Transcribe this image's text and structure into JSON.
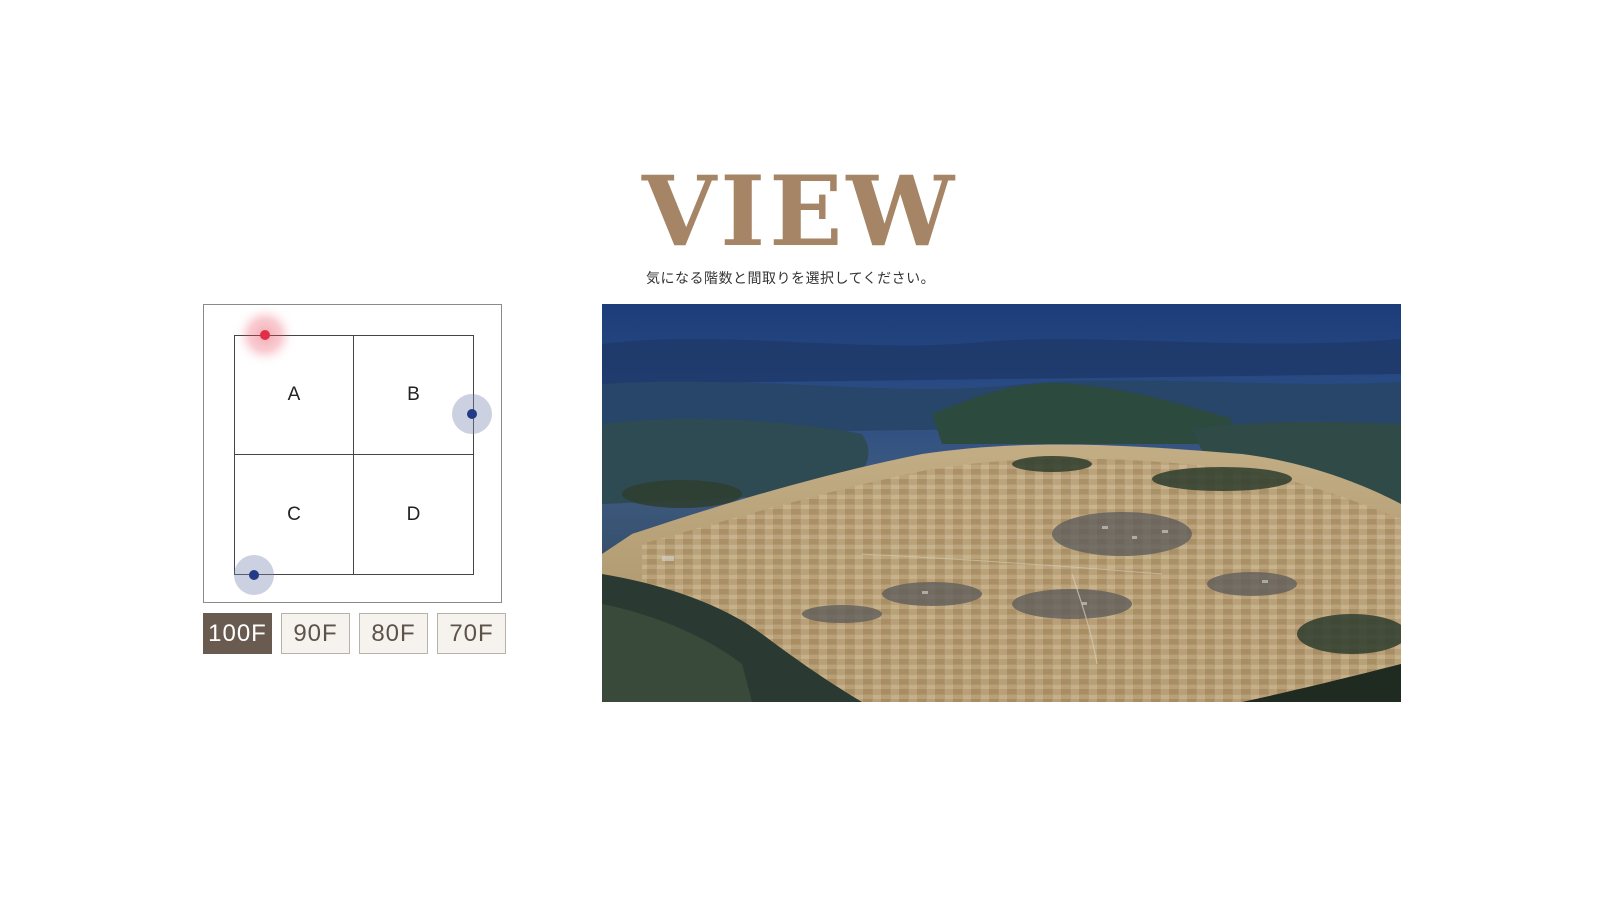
{
  "header": {
    "title": "VIEW",
    "instruction": "気になる階数と間取りを選択してください。"
  },
  "floor_plan": {
    "units": [
      "A",
      "B",
      "C",
      "D"
    ],
    "markers": [
      {
        "name": "viewpoint-a-top-left",
        "state": "active"
      },
      {
        "name": "viewpoint-b-right",
        "state": "inactive"
      },
      {
        "name": "viewpoint-c-bottom-left",
        "state": "inactive"
      }
    ]
  },
  "floors": {
    "buttons": [
      "100F",
      "90F",
      "80F",
      "70F"
    ],
    "selected": "100F"
  },
  "colors": {
    "title": "#a58565",
    "active_floor_bg": "#6a5b50",
    "inactive_floor_bg": "#f6f2ee",
    "active_marker": "#e03048",
    "inactive_marker": "#233a86"
  }
}
